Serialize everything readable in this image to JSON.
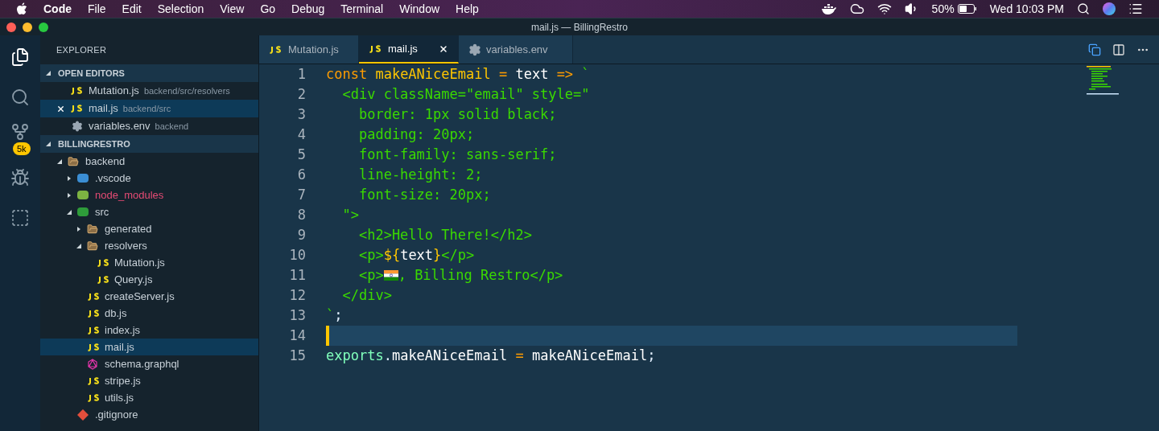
{
  "menu_bar": {
    "app_name": "Code",
    "menus": [
      "File",
      "Edit",
      "Selection",
      "View",
      "Go",
      "Debug",
      "Terminal",
      "Window",
      "Help"
    ],
    "battery_percent": "50%",
    "clock": "Wed 10:03 PM"
  },
  "window": {
    "title": "mail.js — BillingRestro"
  },
  "activity_bar": {
    "items": [
      {
        "selected": true
      },
      {
        "selected": false
      },
      {
        "selected": false,
        "badge": "5k"
      },
      {
        "selected": false
      },
      {
        "selected": false
      }
    ]
  },
  "sidebar": {
    "title": "EXPLORER",
    "open_editors": {
      "title": "OPEN EDITORS",
      "expanded": true,
      "items": [
        {
          "label": "Mutation.js",
          "path": "backend/src/resolvers",
          "kind": "js",
          "selected": false
        },
        {
          "label": "mail.js",
          "path": "backend/src",
          "kind": "js",
          "selected": true
        },
        {
          "label": "variables.env",
          "path": "backend",
          "kind": "config",
          "selected": false
        }
      ]
    },
    "project": {
      "title": "BILLINGRESTRO",
      "expanded": true,
      "tree": [
        {
          "label": "backend",
          "kind": "folder",
          "expanded": true,
          "selected": false,
          "ignored": false,
          "children": [
            {
              "label": ".vscode",
              "kind": "editor-folder",
              "expanded": false,
              "selected": false,
              "ignored": false
            },
            {
              "label": "node_modules",
              "kind": "node-folder",
              "expanded": false,
              "selected": false,
              "ignored": true
            },
            {
              "label": "src",
              "kind": "source-folder",
              "expanded": true,
              "selected": false,
              "ignored": false,
              "children": [
                {
                  "label": "generated",
                  "kind": "folder",
                  "expanded": false,
                  "selected": false,
                  "ignored": false
                },
                {
                  "label": "resolvers",
                  "kind": "folder",
                  "expanded": true,
                  "selected": false,
                  "ignored": false,
                  "children": [
                    {
                      "label": "Mutation.js",
                      "kind": "js",
                      "selected": false,
                      "ignored": false
                    },
                    {
                      "label": "Query.js",
                      "kind": "js",
                      "selected": false,
                      "ignored": false
                    }
                  ]
                },
                {
                  "label": "createServer.js",
                  "kind": "js",
                  "selected": false,
                  "ignored": false
                },
                {
                  "label": "db.js",
                  "kind": "js",
                  "selected": false,
                  "ignored": false
                },
                {
                  "label": "index.js",
                  "kind": "js",
                  "selected": false,
                  "ignored": false
                },
                {
                  "label": "mail.js",
                  "kind": "js",
                  "selected": true,
                  "ignored": false
                },
                {
                  "label": "schema.graphql",
                  "kind": "graphql",
                  "selected": false,
                  "ignored": false
                },
                {
                  "label": "stripe.js",
                  "kind": "js",
                  "selected": false,
                  "ignored": false
                },
                {
                  "label": "utils.js",
                  "kind": "js",
                  "selected": false,
                  "ignored": false
                }
              ]
            },
            {
              "label": ".gitignore",
              "kind": "git",
              "selected": false,
              "ignored": false
            }
          ]
        }
      ]
    }
  },
  "tabs": [
    {
      "label": "Mutation.js",
      "kind": "js",
      "selected": false
    },
    {
      "label": "mail.js",
      "kind": "js",
      "selected": true
    },
    {
      "label": "variables.env",
      "kind": "config",
      "selected": false
    }
  ],
  "editor": {
    "lines": [
      {
        "number": "1",
        "selected": false,
        "tokens": [
          {
            "kind": "keyword",
            "text": "const "
          },
          {
            "kind": "function",
            "text": "makeANiceEmail "
          },
          {
            "kind": "operator",
            "text": "= "
          },
          {
            "kind": "plain",
            "text": "text "
          },
          {
            "kind": "operator",
            "text": "=> "
          },
          {
            "kind": "string",
            "text": "`"
          }
        ]
      },
      {
        "number": "2",
        "selected": false,
        "tokens": [
          {
            "kind": "string",
            "text": "  <div className=\"email\" style=\""
          }
        ]
      },
      {
        "number": "3",
        "selected": false,
        "tokens": [
          {
            "kind": "string",
            "text": "    border: 1px solid black;"
          }
        ]
      },
      {
        "number": "4",
        "selected": false,
        "tokens": [
          {
            "kind": "string",
            "text": "    padding: 20px;"
          }
        ]
      },
      {
        "number": "5",
        "selected": false,
        "tokens": [
          {
            "kind": "string",
            "text": "    font-family: sans-serif;"
          }
        ]
      },
      {
        "number": "6",
        "selected": false,
        "tokens": [
          {
            "kind": "string",
            "text": "    line-height: 2;"
          }
        ]
      },
      {
        "number": "7",
        "selected": false,
        "tokens": [
          {
            "kind": "string",
            "text": "    font-size: 20px;"
          }
        ]
      },
      {
        "number": "8",
        "selected": false,
        "tokens": [
          {
            "kind": "string",
            "text": "  \">"
          }
        ]
      },
      {
        "number": "9",
        "selected": false,
        "tokens": [
          {
            "kind": "string",
            "text": "    <h2>Hello There!</h2>"
          }
        ]
      },
      {
        "number": "10",
        "selected": false,
        "tokens": [
          {
            "kind": "string",
            "text": "    <p>"
          },
          {
            "kind": "function",
            "text": "${"
          },
          {
            "kind": "plain",
            "text": "text"
          },
          {
            "kind": "function",
            "text": "}"
          },
          {
            "kind": "string",
            "text": "</p>"
          }
        ]
      },
      {
        "number": "11",
        "selected": false,
        "tokens": [
          {
            "kind": "string",
            "text": "    <p>"
          },
          {
            "kind": "flag"
          },
          {
            "kind": "string",
            "text": ", Billing Restro</p>"
          }
        ]
      },
      {
        "number": "12",
        "selected": false,
        "tokens": [
          {
            "kind": "string",
            "text": "  </div>"
          }
        ]
      },
      {
        "number": "13",
        "selected": false,
        "tokens": [
          {
            "kind": "string",
            "text": "`"
          },
          {
            "kind": "punct",
            "text": ";"
          }
        ]
      },
      {
        "number": "14",
        "selected": true
      },
      {
        "number": "15",
        "selected": false,
        "tokens": [
          {
            "kind": "builtin",
            "text": "exports"
          },
          {
            "kind": "punct",
            "text": "."
          },
          {
            "kind": "plain",
            "text": "makeANiceEmail "
          },
          {
            "kind": "operator",
            "text": "= "
          },
          {
            "kind": "plain",
            "text": "makeANiceEmail"
          },
          {
            "kind": "punct",
            "text": ";"
          }
        ]
      }
    ]
  }
}
